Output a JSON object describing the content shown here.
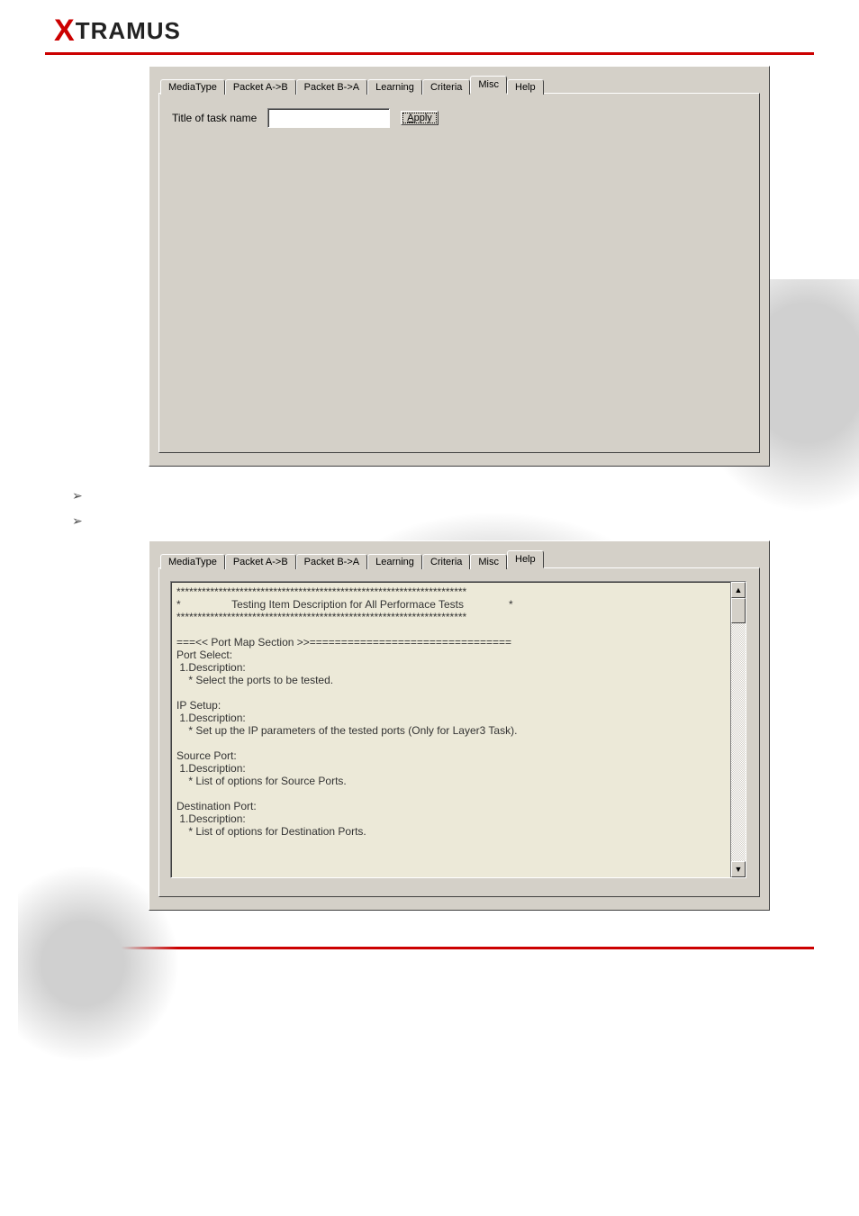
{
  "brand": {
    "logo_prefix": "X",
    "logo_rest": "TRAMUS"
  },
  "tabs": {
    "mediatype": "MediaType",
    "packet_ab": "Packet A->B",
    "packet_ba": "Packet B->A",
    "learning": "Learning",
    "criteria": "Criteria",
    "misc": "Misc",
    "help": "Help"
  },
  "misc_panel": {
    "title_label": "Title of task name",
    "title_value": "",
    "apply_label": "Apply"
  },
  "bullets": {
    "b1": "",
    "b2": ""
  },
  "help_panel": {
    "text": "*********************************************************************\n*                 Testing Item Description for All Performace Tests               *\n*********************************************************************\n\n===<< Port Map Section >>================================\nPort Select:\n 1.Description:\n    * Select the ports to be tested.\n\nIP Setup:\n 1.Description:\n    * Set up the IP parameters of the tested ports (Only for Layer3 Task).\n\nSource Port:\n 1.Description:\n    * List of options for Source Ports.\n\nDestination Port:\n 1.Description:\n    * List of options for Destination Ports."
  }
}
